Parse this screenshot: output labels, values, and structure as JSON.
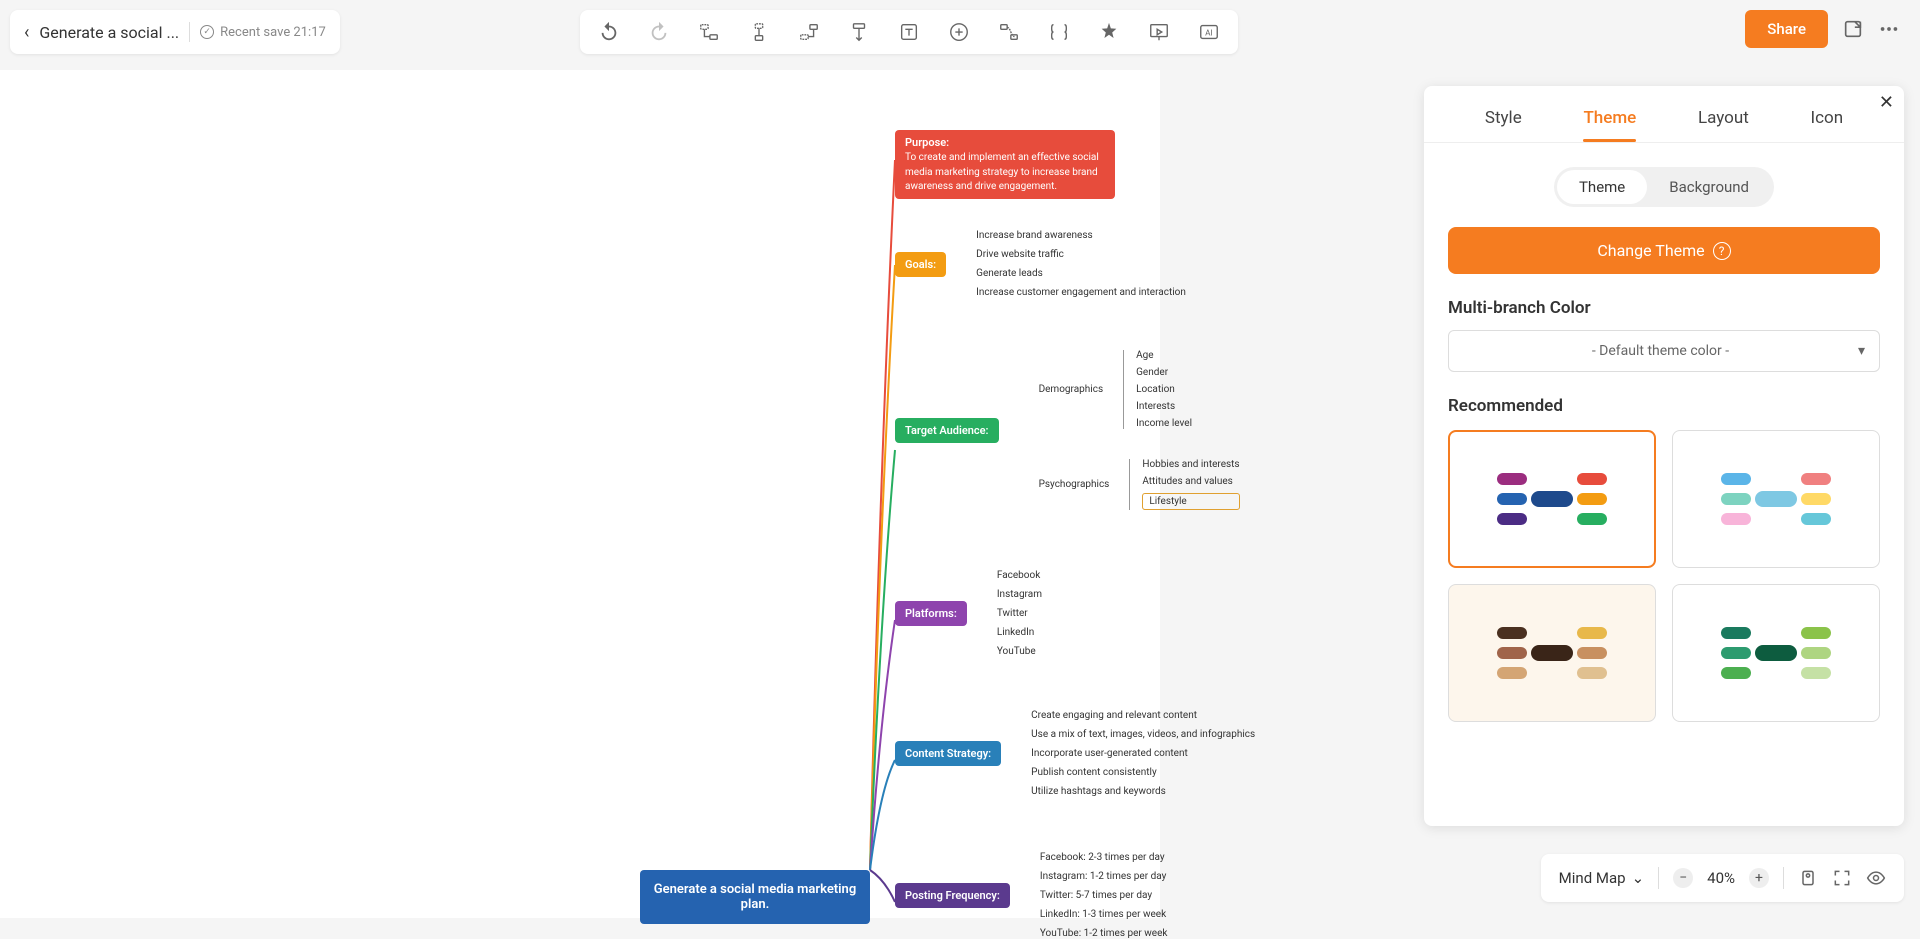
{
  "header": {
    "doc_title": "Generate a social ...",
    "save_text": "Recent save 21:17"
  },
  "top_right": {
    "share": "Share"
  },
  "panel": {
    "tabs": [
      "Style",
      "Theme",
      "Layout",
      "Icon"
    ],
    "sub_tabs": [
      "Theme",
      "Background"
    ],
    "change_theme": "Change Theme",
    "multi_branch_title": "Multi-branch Color",
    "color_select": "- Default theme color -",
    "recommended_title": "Recommended"
  },
  "bottom": {
    "view_type": "Mind Map",
    "zoom": "40%"
  },
  "mindmap": {
    "root": "Generate a social media marketing plan.",
    "purpose": {
      "label": "Purpose:",
      "text": "To create and implement an effective social media marketing strategy to increase brand awareness and drive engagement."
    },
    "goals": {
      "label": "Goals:",
      "items": [
        "Increase brand awareness",
        "Drive website traffic",
        "Generate leads",
        "Increase customer engagement and interaction"
      ]
    },
    "audience": {
      "label": "Target Audience:",
      "demographics": {
        "label": "Demographics",
        "items": [
          "Age",
          "Gender",
          "Location",
          "Interests",
          "Income level"
        ]
      },
      "psychographics": {
        "label": "Psychographics",
        "items": [
          "Hobbies and interests",
          "Attitudes and values",
          "Lifestyle"
        ]
      }
    },
    "platforms": {
      "label": "Platforms:",
      "items": [
        "Facebook",
        "Instagram",
        "Twitter",
        "LinkedIn",
        "YouTube"
      ]
    },
    "content": {
      "label": "Content Strategy:",
      "items": [
        "Create engaging and relevant content",
        "Use a mix of text, images, videos, and infographics",
        "Incorporate user-generated content",
        "Publish content consistently",
        "Utilize hashtags and keywords"
      ]
    },
    "posting": {
      "label": "Posting Frequency:",
      "items": [
        "Facebook: 2-3 times per day",
        "Instagram: 1-2 times per day",
        "Twitter: 5-7 times per day",
        "LinkedIn: 1-3 times per week",
        "YouTube: 1-2 times per week"
      ]
    }
  }
}
